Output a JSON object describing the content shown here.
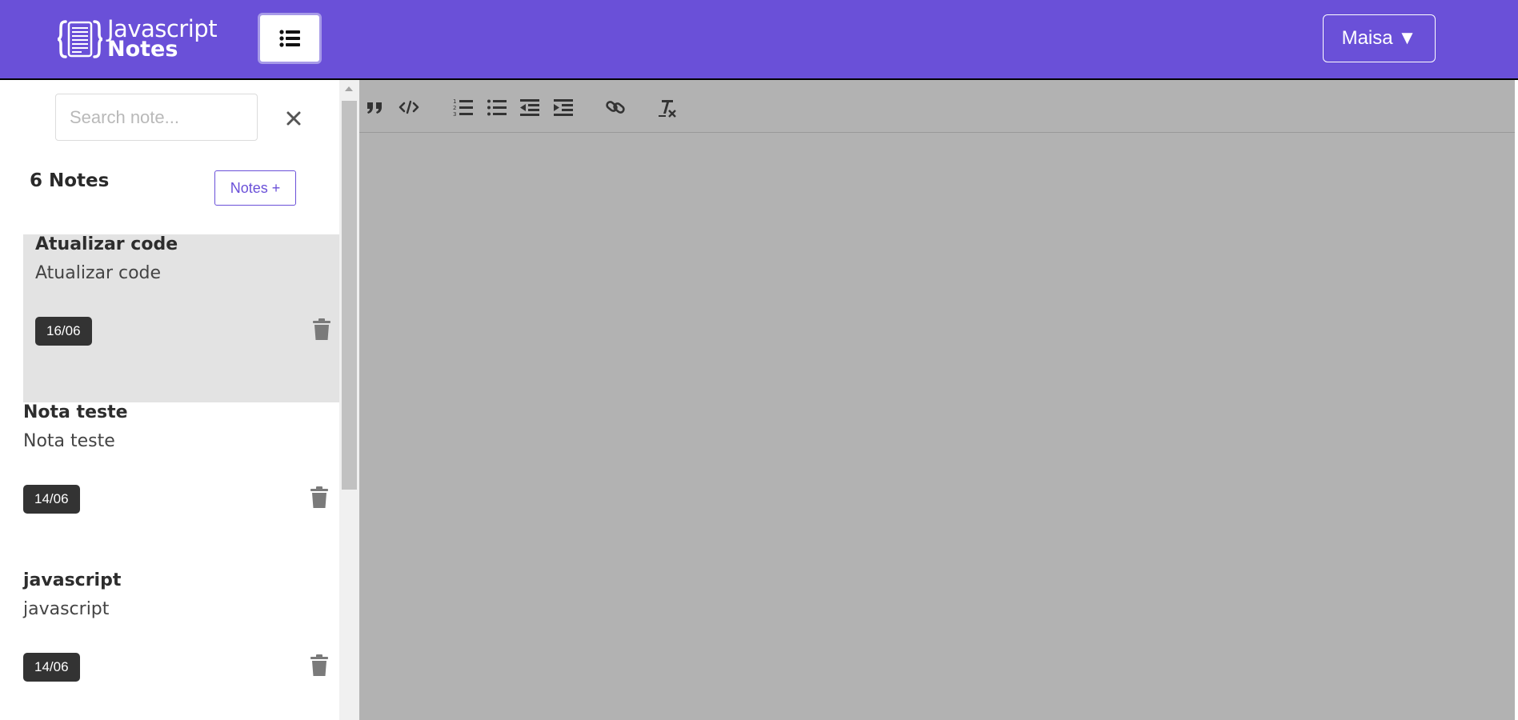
{
  "header": {
    "logo_line1": "Javascript",
    "logo_line2": "Notes",
    "menu_icon": "list-icon",
    "user_label": "Maisa",
    "user_caret": "▼",
    "bg_color": "#6a50d8"
  },
  "sidebar": {
    "search_placeholder": "Search note...",
    "search_value": "",
    "clear_icon": "close-icon",
    "notes_count_label": "6 Notes",
    "add_button_label": "Notes +",
    "notes": [
      {
        "title": "Atualizar code",
        "body": "Atualizar code",
        "date": "16/06",
        "selected": true
      },
      {
        "title": "Nota teste",
        "body": "Nota teste",
        "date": "14/06",
        "selected": false
      },
      {
        "title": "javascript",
        "body": "javascript",
        "date": "14/06",
        "selected": false
      }
    ]
  },
  "editor": {
    "toolbar_icons": [
      "quote-icon",
      "code-icon",
      "ordered-list-icon",
      "bullet-list-icon",
      "outdent-icon",
      "indent-icon",
      "link-icon",
      "clear-format-icon"
    ],
    "bg_color": "#b2b2b2"
  }
}
